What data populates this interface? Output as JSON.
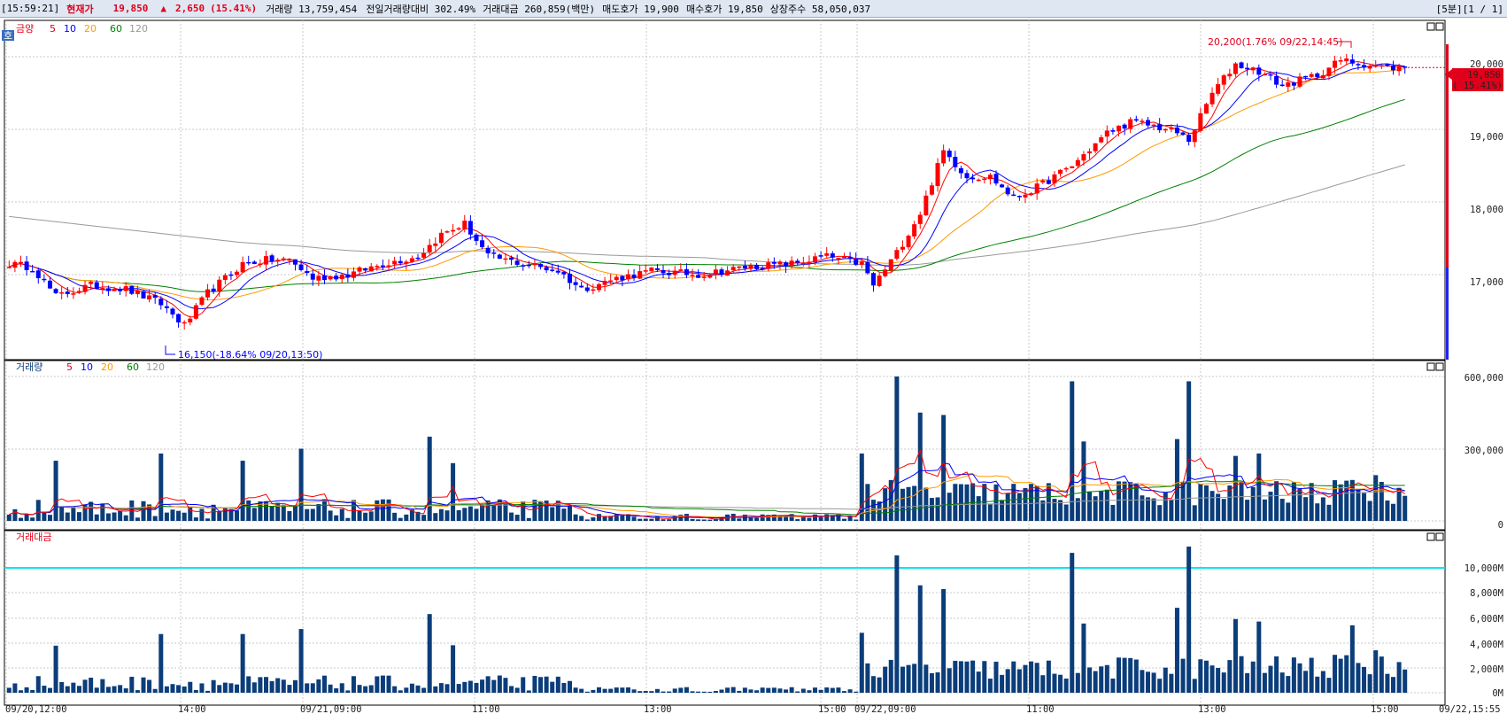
{
  "header": {
    "time": "[15:59:21]",
    "price_label": "현재가",
    "price": "19,850",
    "change_arrow": "▲",
    "change": "2,650",
    "change_pct": "(15.41%)",
    "volume": "거래량 13,759,454",
    "vol_ratio": "전일거래량대비 302.49%",
    "amount": "거래대금 260,859(백만)",
    "ask": "매도호가 19,900",
    "bid": "매수호가 19,850",
    "shares": "상장주수 58,050,037",
    "period": "[5분][1 / 1]"
  },
  "colors": {
    "up": "#ff0000",
    "down": "#0000ff",
    "ma5": "#ff0000",
    "ma10": "#0000ff",
    "ma20": "#ff9900",
    "ma60": "#008000",
    "ma120": "#999999",
    "volume_bar": "#0b3d7a",
    "threshold": "#00e5ee"
  },
  "panels": {
    "price": {
      "legend_title": "금양",
      "ma_labels": [
        "5",
        "10",
        "20",
        "60",
        "120"
      ],
      "y_ticks": [
        "20,000",
        "19,000",
        "18,000",
        "17,000"
      ],
      "current_price": "19,850",
      "current_pct": "( 15.41%)",
      "high_note": "20,200(1.76% 09/22,14:45)",
      "low_note": "16,150(-18.64% 09/20,13:50)"
    },
    "volume": {
      "legend_title": "거래량",
      "ma_labels": [
        "5",
        "10",
        "20",
        "60",
        "120"
      ],
      "y_ticks": [
        "600,000",
        "300,000",
        "0"
      ]
    },
    "amount": {
      "legend_title": "거래대금",
      "y_ticks": [
        "10,000M",
        "8,000M",
        "6,000M",
        "4,000M",
        "2,000M",
        "0M"
      ]
    }
  },
  "x_axis": {
    "labels": [
      "09/20,12:00",
      "14:00",
      "09/21,09:00",
      "11:00",
      "13:00",
      "15:00",
      "09/22,09:00",
      "11:00",
      "13:00",
      "15:00"
    ],
    "end_label": "09/22,15:55"
  },
  "chart_data": {
    "type": "candlestick",
    "interval": "5분",
    "price_anchors": [
      [
        0,
        17150
      ],
      [
        4,
        17100
      ],
      [
        8,
        16700
      ],
      [
        14,
        16850
      ],
      [
        20,
        16800
      ],
      [
        26,
        16600
      ],
      [
        30,
        16300
      ],
      [
        34,
        16750
      ],
      [
        40,
        17150
      ],
      [
        44,
        17200
      ],
      [
        48,
        17200
      ],
      [
        52,
        16950
      ],
      [
        58,
        17000
      ],
      [
        64,
        17150
      ],
      [
        70,
        17250
      ],
      [
        74,
        17550
      ],
      [
        78,
        17700
      ],
      [
        82,
        17250
      ],
      [
        88,
        17150
      ],
      [
        94,
        17050
      ],
      [
        98,
        16800
      ],
      [
        104,
        16950
      ],
      [
        110,
        17050
      ],
      [
        118,
        17000
      ],
      [
        126,
        17100
      ],
      [
        134,
        17150
      ],
      [
        140,
        17250
      ],
      [
        146,
        17150
      ],
      [
        148,
        16850
      ],
      [
        152,
        17300
      ],
      [
        156,
        17850
      ],
      [
        160,
        18700
      ],
      [
        164,
        18350
      ],
      [
        168,
        18350
      ],
      [
        172,
        18050
      ],
      [
        176,
        18200
      ],
      [
        182,
        18500
      ],
      [
        188,
        18950
      ],
      [
        192,
        19100
      ],
      [
        196,
        19050
      ],
      [
        200,
        18950
      ],
      [
        202,
        18850
      ],
      [
        206,
        19500
      ],
      [
        210,
        19900
      ],
      [
        214,
        19800
      ],
      [
        218,
        19600
      ],
      [
        224,
        19750
      ],
      [
        228,
        19950
      ],
      [
        232,
        19900
      ],
      [
        236,
        19850
      ]
    ],
    "volume_scale": {
      "min": 0,
      "max": 600000
    },
    "amount_scale": {
      "min": 0,
      "max": 10000,
      "unit": "M",
      "threshold": 10000
    },
    "volume_spikes": [
      [
        8,
        250000
      ],
      [
        26,
        280000
      ],
      [
        40,
        250000
      ],
      [
        50,
        300000
      ],
      [
        72,
        350000
      ],
      [
        76,
        240000
      ],
      [
        146,
        280000
      ],
      [
        152,
        600000
      ],
      [
        156,
        450000
      ],
      [
        160,
        440000
      ],
      [
        182,
        580000
      ],
      [
        184,
        330000
      ],
      [
        200,
        340000
      ],
      [
        202,
        580000
      ],
      [
        210,
        270000
      ],
      [
        214,
        280000
      ],
      [
        230,
        170000
      ],
      [
        234,
        190000
      ]
    ],
    "amount_spikes": [
      [
        26,
        4700
      ],
      [
        40,
        4700
      ],
      [
        50,
        5100
      ],
      [
        72,
        6300
      ],
      [
        146,
        4800
      ],
      [
        152,
        11000
      ],
      [
        156,
        8600
      ],
      [
        160,
        8300
      ],
      [
        182,
        11200
      ],
      [
        200,
        6800
      ],
      [
        202,
        11700
      ],
      [
        210,
        5900
      ],
      [
        214,
        5700
      ],
      [
        230,
        5400
      ]
    ]
  }
}
